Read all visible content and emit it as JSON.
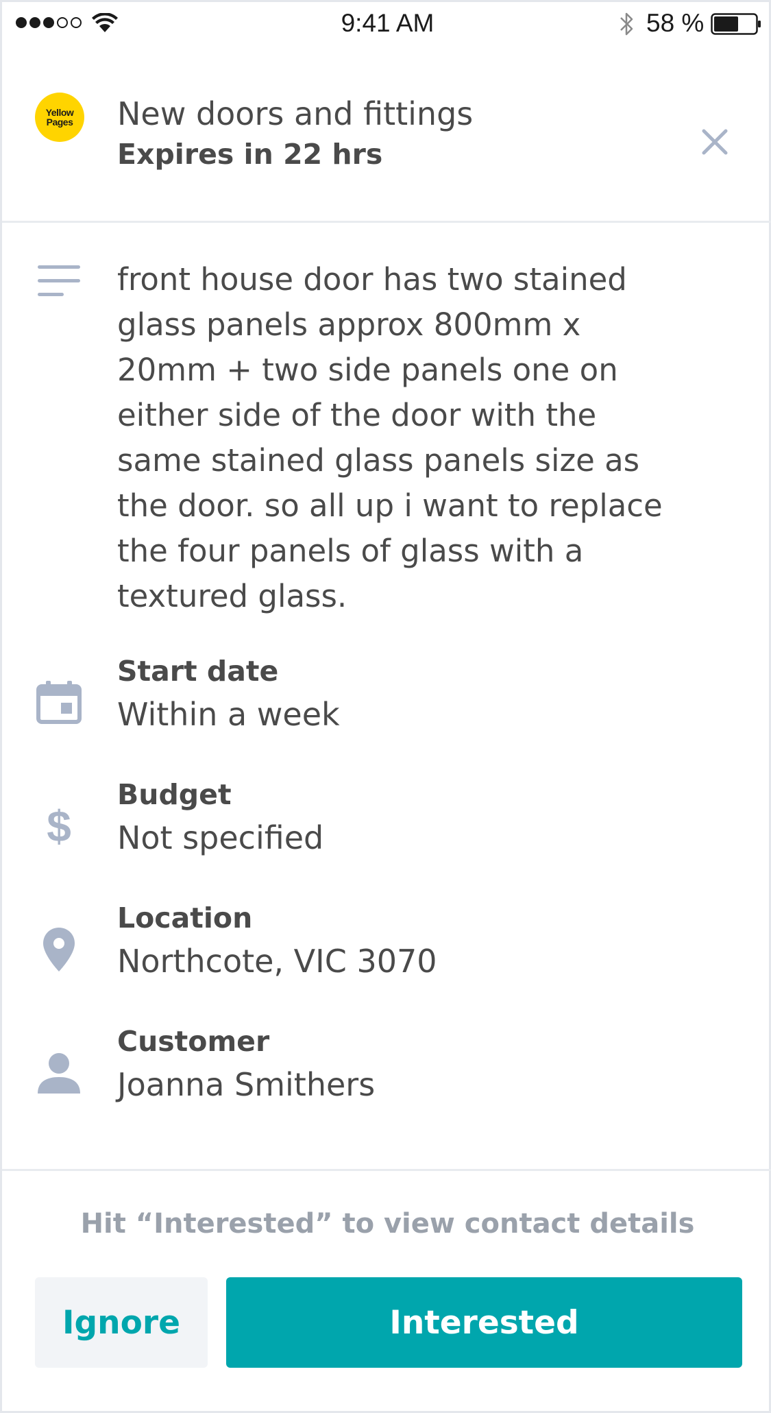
{
  "status_bar": {
    "time": "9:41 AM",
    "battery_percent": "58 %",
    "signal_bars_filled": 3,
    "signal_bars_total": 5
  },
  "header": {
    "logo_text_line1": "Yellow",
    "logo_text_line2": "Pages",
    "title": "New doors and fittings",
    "expiry": "Expires in 22 hrs",
    "close_icon": "close-icon"
  },
  "description": {
    "icon": "text-lines-icon",
    "text": "front house door has two stained glass panels approx 800mm x 20mm + two side panels one on either side of the door with the same stained glass panels size as the door. so all up i want to replace the four panels of glass with a textured glass."
  },
  "fields": [
    {
      "icon": "calendar-icon",
      "label": "Start date",
      "value": "Within a week"
    },
    {
      "icon": "dollar-icon",
      "label": "Budget",
      "value": "Not specified"
    },
    {
      "icon": "location-pin-icon",
      "label": "Location",
      "value": "Northcote, VIC 3070"
    },
    {
      "icon": "person-icon",
      "label": "Customer",
      "value": "Joanna Smithers"
    }
  ],
  "footer": {
    "hint": "Hit “Interested” to view contact details",
    "ignore_label": "Ignore",
    "interested_label": "Interested"
  },
  "colors": {
    "accent": "#00a6ad",
    "icon_gray": "#a9b4c8",
    "text": "#4a4a4a",
    "hint": "#9aa1ab",
    "logo_yellow": "#ffd400"
  }
}
